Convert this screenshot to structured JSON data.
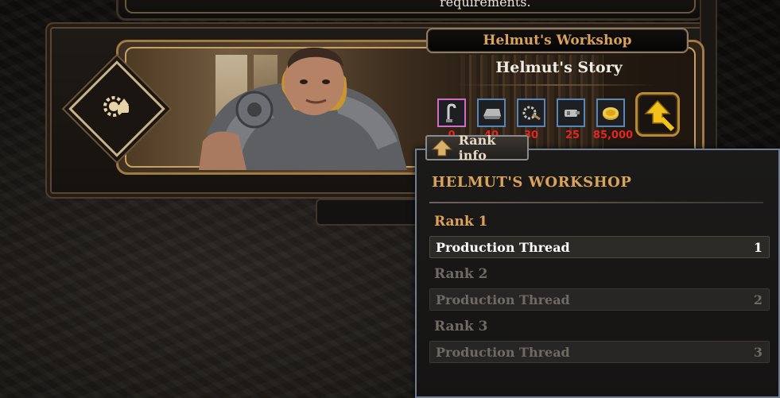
{
  "top_panel": {
    "text": "requirements."
  },
  "building": {
    "name": "Helmut's Workshop",
    "story_title": "Helmut's Story"
  },
  "resources": [
    {
      "icon": "hook-icon",
      "count": "0",
      "border": "#d36bc9"
    },
    {
      "icon": "ingot-icon",
      "count": "40",
      "border": "#5a86b5"
    },
    {
      "icon": "gear-part-icon",
      "count": "30",
      "border": "#5a86b5"
    },
    {
      "icon": "device-icon",
      "count": "25",
      "border": "#5a86b5"
    },
    {
      "icon": "gold-coin-icon",
      "count": "85,000",
      "border": "#5a86b5"
    }
  ],
  "rank_tab": {
    "label": "Rank info"
  },
  "tooltip": {
    "title": "HELMUT'S WORKSHOP",
    "ranks": [
      {
        "heading": "Rank 1",
        "label": "Production Thread",
        "value": "1",
        "active": true
      },
      {
        "heading": "Rank 2",
        "label": "Production Thread",
        "value": "2",
        "active": false
      },
      {
        "heading": "Rank 3",
        "label": "Production Thread",
        "value": "3",
        "active": false
      }
    ]
  },
  "colors": {
    "accent_gold": "#d9a35a",
    "cost_red": "#e52520",
    "slot_blue": "#5a86b5",
    "slot_pink": "#d36bc9"
  }
}
